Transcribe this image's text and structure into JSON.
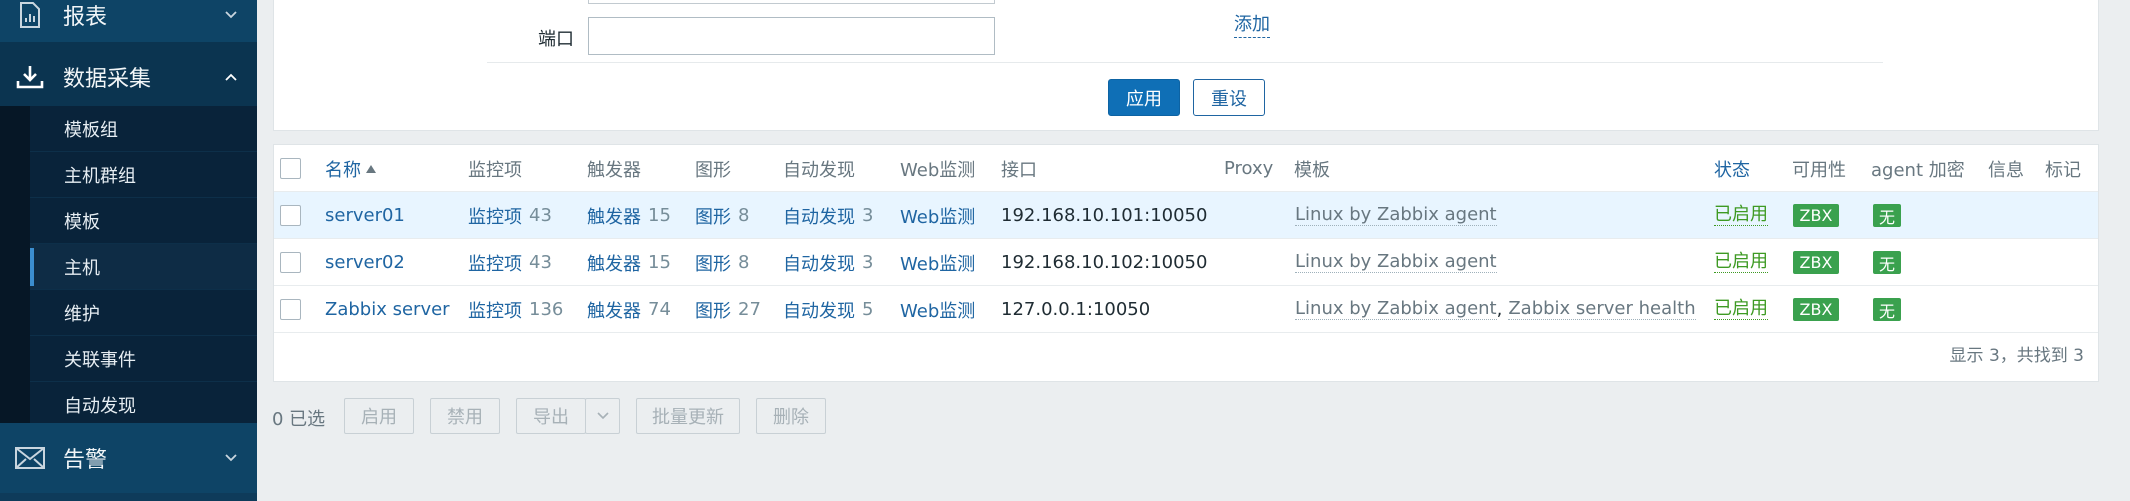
{
  "sidebar": {
    "sections": [
      {
        "label": "报表",
        "icon": "report-icon"
      },
      {
        "label": "数据采集",
        "icon": "download-icon"
      },
      {
        "label": "告警",
        "icon": "mail-icon"
      }
    ],
    "items": [
      {
        "label": "模板组"
      },
      {
        "label": "主机群组"
      },
      {
        "label": "模板"
      },
      {
        "label": "主机"
      },
      {
        "label": "维护"
      },
      {
        "label": "关联事件"
      },
      {
        "label": "自动发现"
      }
    ]
  },
  "filter": {
    "port_label": "端口",
    "port_value": "",
    "add_link": "添加",
    "apply": "应用",
    "reset": "重设"
  },
  "table": {
    "headers": {
      "name": "名称",
      "items": "监控项",
      "triggers": "触发器",
      "graphs": "图形",
      "discovery": "自动发现",
      "web": "Web监测",
      "interface": "接口",
      "proxy": "Proxy",
      "templates": "模板",
      "status": "状态",
      "availability": "可用性",
      "encryption": "agent 加密",
      "info": "信息",
      "tags": "标记"
    },
    "rows": [
      {
        "name": "server01",
        "items_label": "监控项",
        "items_count": "43",
        "triggers_label": "触发器",
        "triggers_count": "15",
        "graphs_label": "图形",
        "graphs_count": "8",
        "discovery_label": "自动发现",
        "discovery_count": "3",
        "web": "Web监测",
        "interface": "192.168.10.101:10050",
        "template1": "Linux by Zabbix agent",
        "status": "已启用",
        "availability": "ZBX",
        "encryption": "无"
      },
      {
        "name": "server02",
        "items_label": "监控项",
        "items_count": "43",
        "triggers_label": "触发器",
        "triggers_count": "15",
        "graphs_label": "图形",
        "graphs_count": "8",
        "discovery_label": "自动发现",
        "discovery_count": "3",
        "web": "Web监测",
        "interface": "192.168.10.102:10050",
        "template1": "Linux by Zabbix agent",
        "status": "已启用",
        "availability": "ZBX",
        "encryption": "无"
      },
      {
        "name": "Zabbix server",
        "items_label": "监控项",
        "items_count": "136",
        "triggers_label": "触发器",
        "triggers_count": "74",
        "graphs_label": "图形",
        "graphs_count": "27",
        "discovery_label": "自动发现",
        "discovery_count": "5",
        "web": "Web监测",
        "interface": "127.0.0.1:10050",
        "template1": "Linux by Zabbix agent",
        "template_sep": ",",
        "template2": "Zabbix server health",
        "status": "已启用",
        "availability": "ZBX",
        "encryption": "无"
      }
    ],
    "footer": "显示 3，共找到 3"
  },
  "actions": {
    "selected": "0 已选",
    "enable": "启用",
    "disable": "禁用",
    "export": "导出",
    "mass_update": "批量更新",
    "delete": "删除"
  },
  "colors": {
    "sidebar": "#0e3b5a",
    "link": "#1f65a2",
    "enabled": "#3e9a23",
    "badge": "#3aa14e",
    "primary_button": "#0f6fb6"
  }
}
